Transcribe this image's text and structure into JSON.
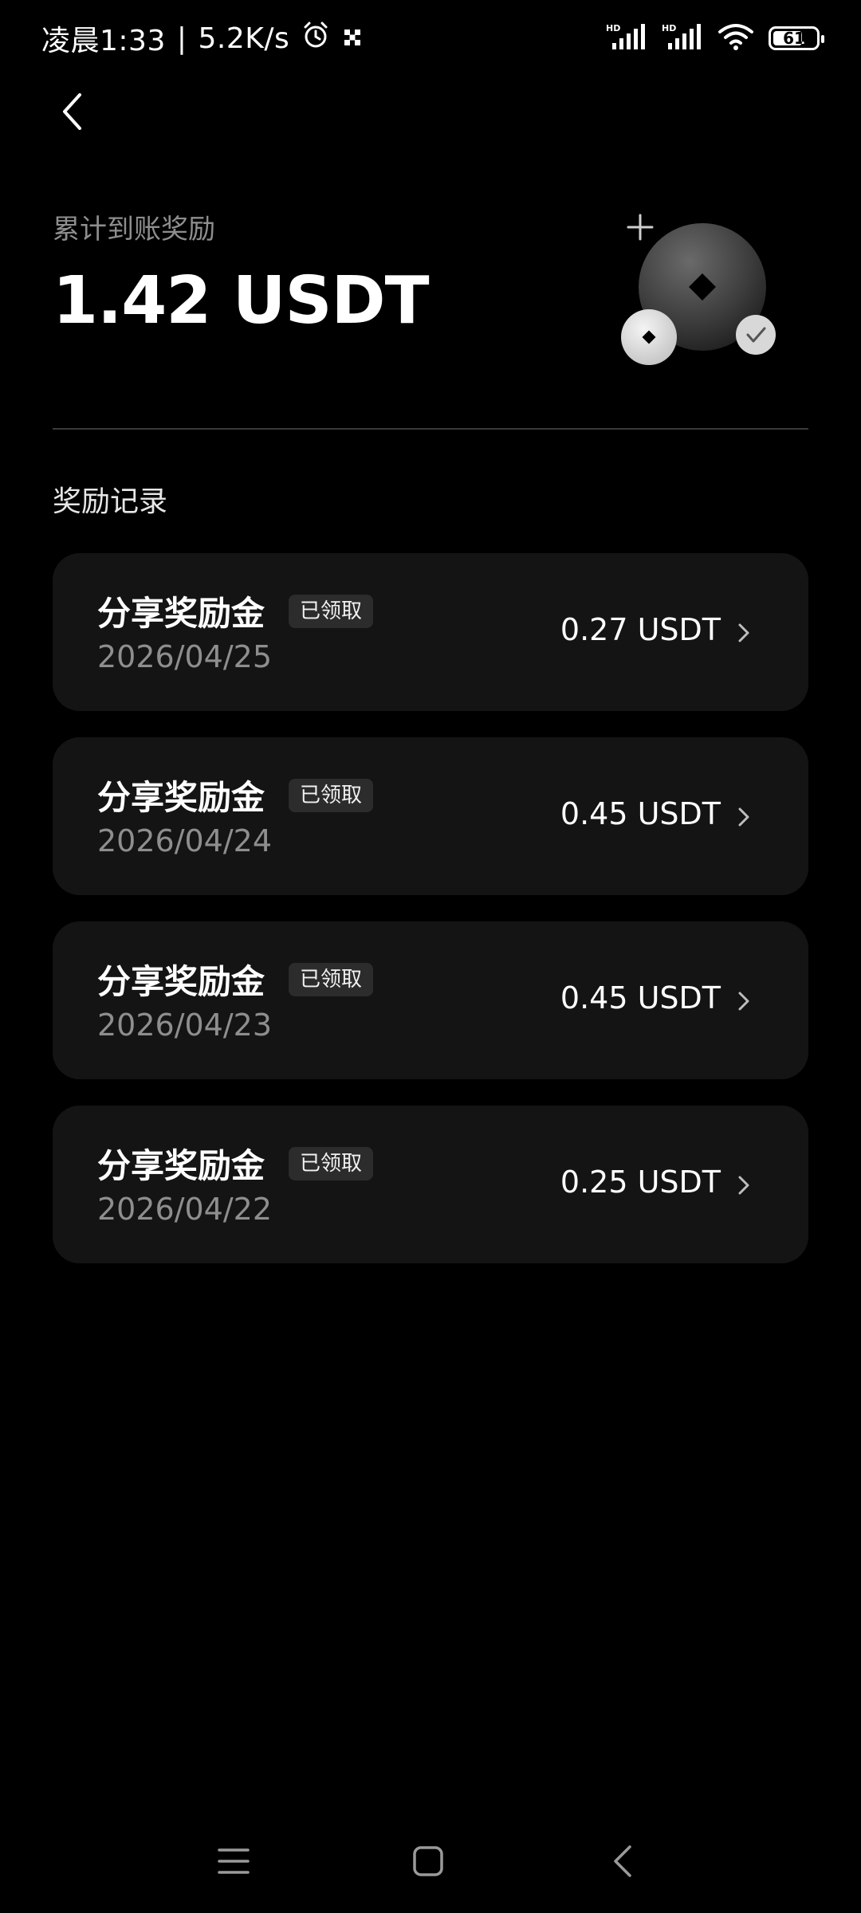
{
  "status_bar": {
    "time": "凌晨1:33",
    "separator": "|",
    "network_speed": "5.2K/s",
    "battery_level": "61",
    "icons": [
      "alarm-icon",
      "app-notification-icon",
      "signal-hd-icon",
      "signal-hd-icon",
      "wifi-icon",
      "battery-icon"
    ]
  },
  "header": {
    "back_icon": "chevron-left-icon"
  },
  "summary": {
    "label": "累计到账奖励",
    "amount": "1.42 USDT"
  },
  "records": {
    "section_title": "奖励记录",
    "items": [
      {
        "title": "分享奖励金",
        "badge": "已领取",
        "date": "2026/04/25",
        "amount": "0.27 USDT"
      },
      {
        "title": "分享奖励金",
        "badge": "已领取",
        "date": "2026/04/24",
        "amount": "0.45 USDT"
      },
      {
        "title": "分享奖励金",
        "badge": "已领取",
        "date": "2026/04/23",
        "amount": "0.45 USDT"
      },
      {
        "title": "分享奖励金",
        "badge": "已领取",
        "date": "2026/04/22",
        "amount": "0.25 USDT"
      }
    ]
  },
  "nav_bar": {
    "icons": [
      "menu-icon",
      "home-square-icon",
      "back-triangle-icon"
    ]
  },
  "colors": {
    "background": "#000000",
    "card": "#141414",
    "secondary_text": "#8e8e8e",
    "badge_bg": "#2c2c2c"
  }
}
